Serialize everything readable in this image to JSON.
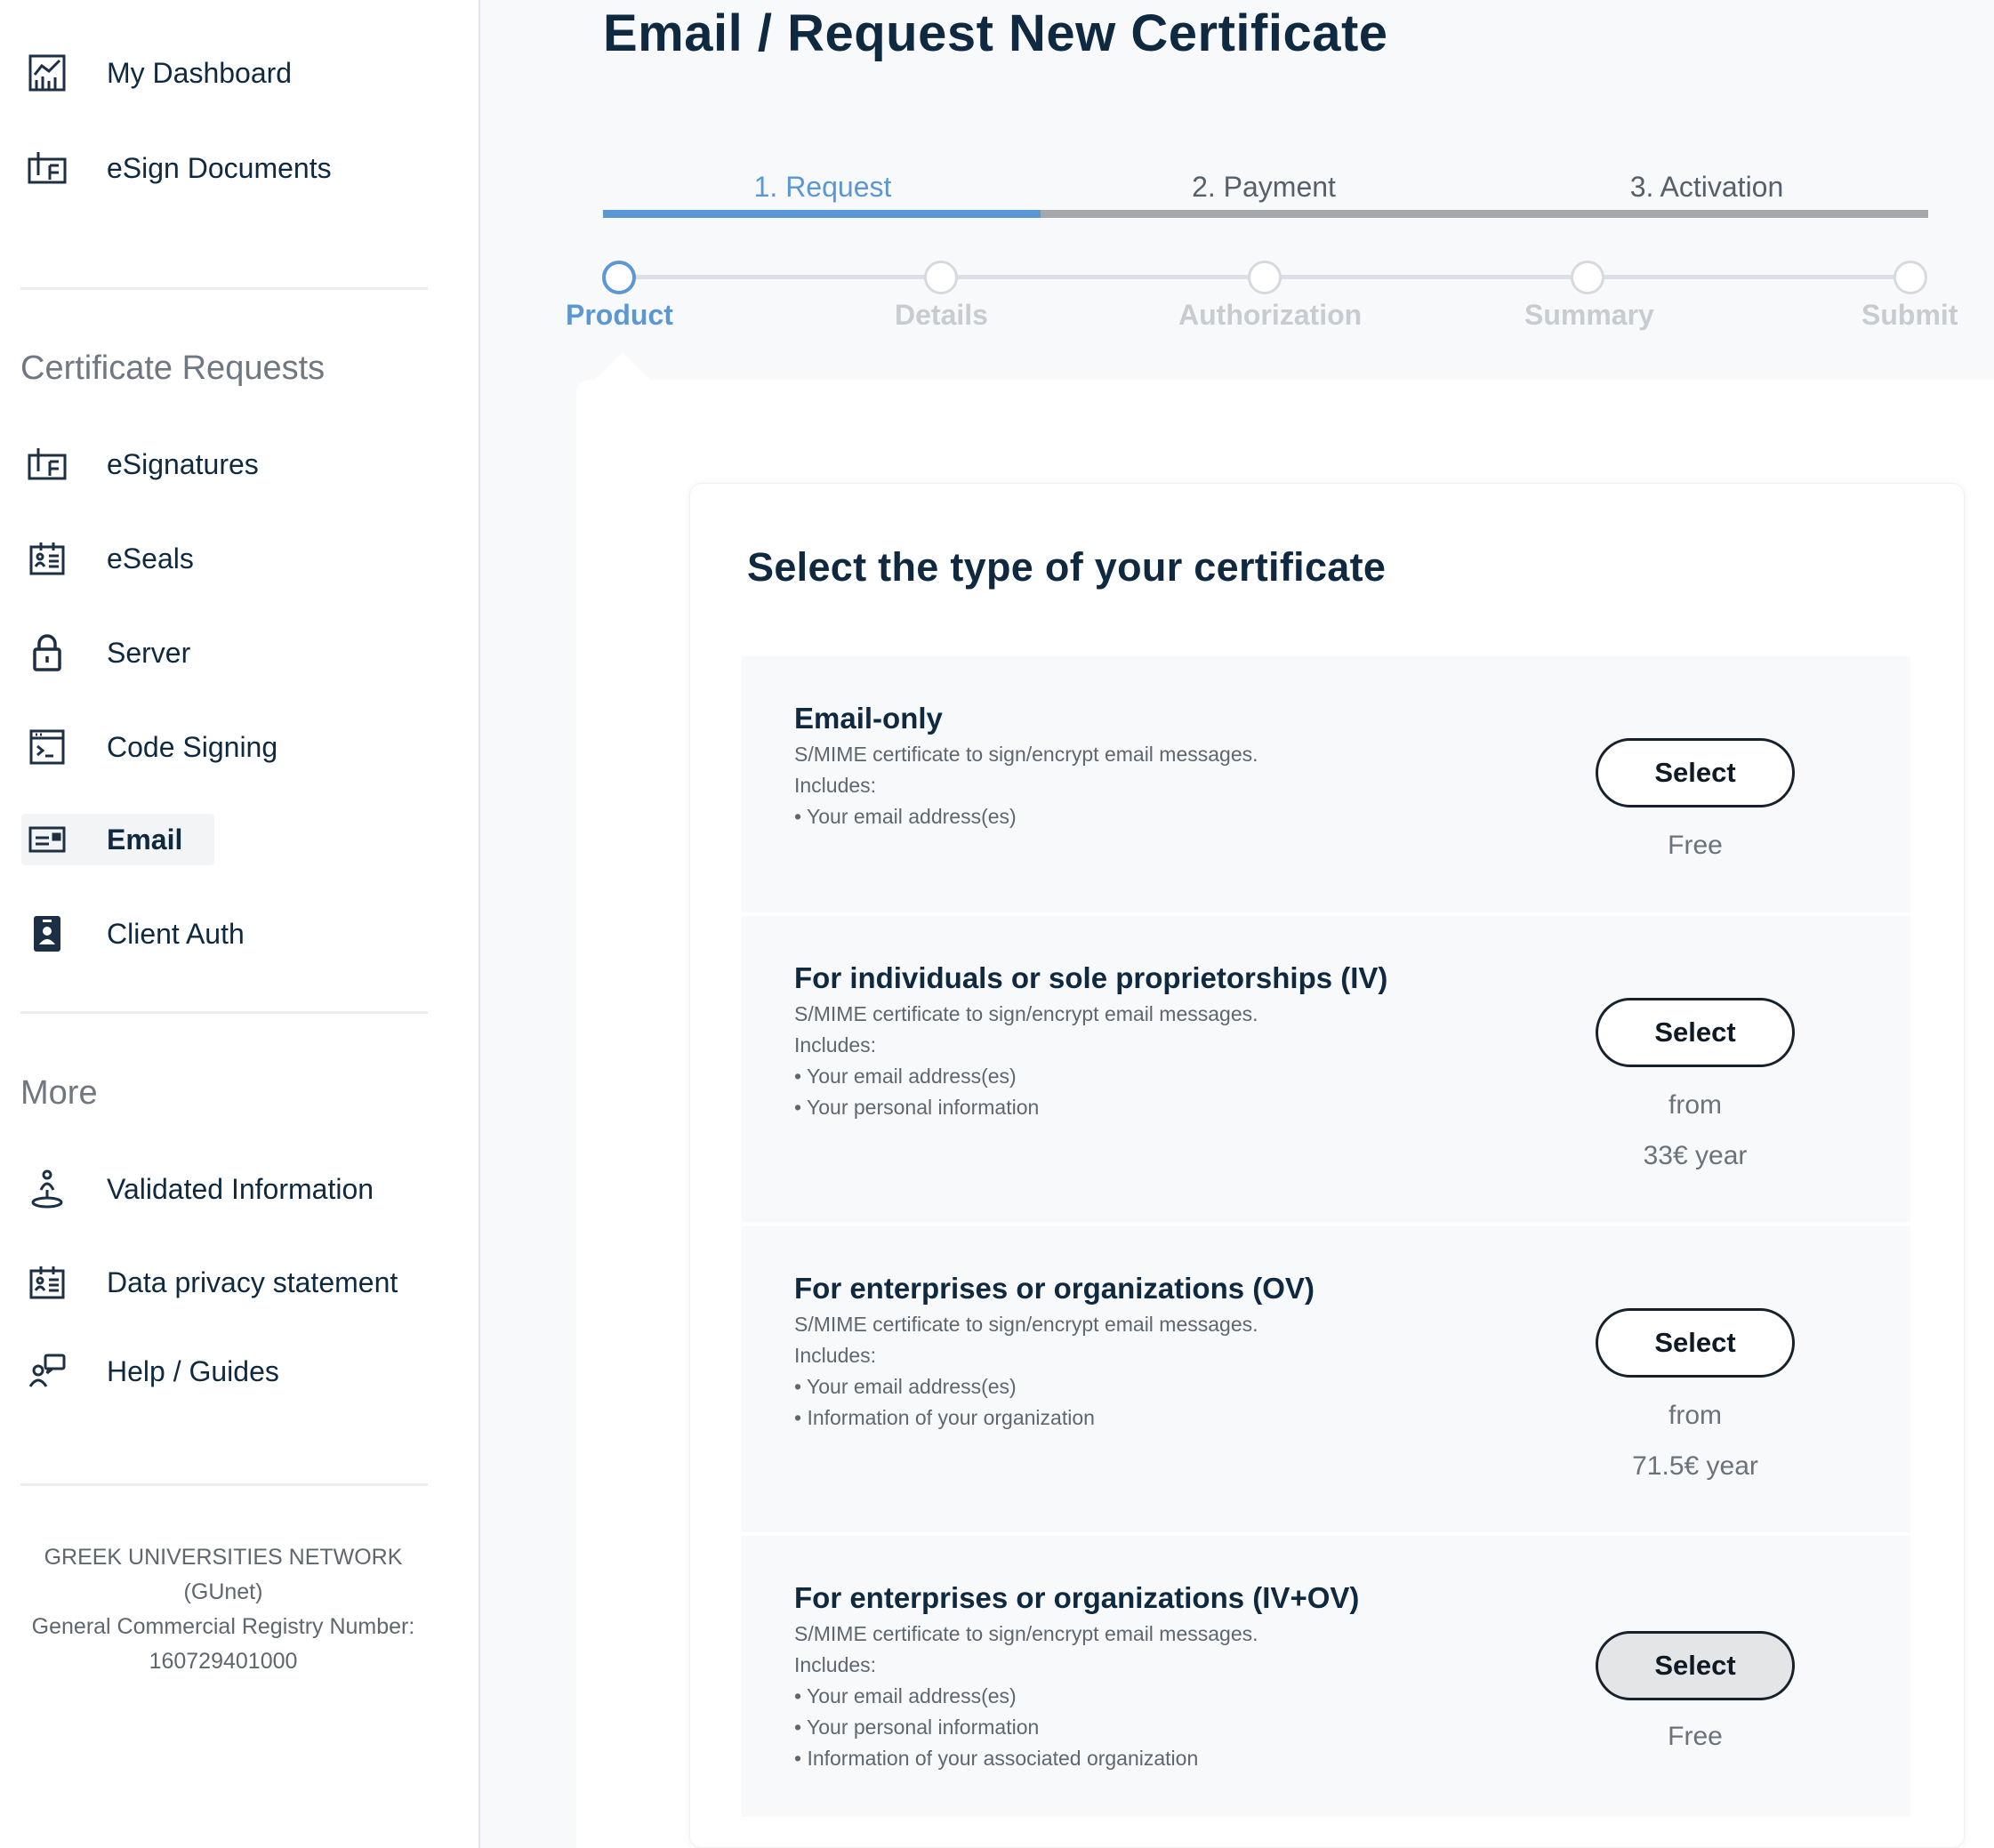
{
  "sidebar": {
    "top_items": [
      {
        "label": "My Dashboard",
        "icon": "dashboard-chart-icon"
      },
      {
        "label": "eSign Documents",
        "icon": "esign-document-icon"
      }
    ],
    "cert_section_title": "Certificate Requests",
    "cert_items": [
      {
        "label": "eSignatures",
        "icon": "esignature-icon"
      },
      {
        "label": "eSeals",
        "icon": "eseal-badge-icon"
      },
      {
        "label": "Server",
        "icon": "lock-icon"
      },
      {
        "label": "Code Signing",
        "icon": "terminal-window-icon"
      },
      {
        "label": "Email",
        "icon": "email-card-icon",
        "active": true
      },
      {
        "label": "Client Auth",
        "icon": "client-badge-icon"
      }
    ],
    "more_section_title": "More",
    "more_items": [
      {
        "label": "Validated Information",
        "icon": "validated-person-icon"
      },
      {
        "label": "Data privacy statement",
        "icon": "privacy-id-card-icon"
      },
      {
        "label": "Help / Guides",
        "icon": "help-chat-icon"
      }
    ],
    "org": {
      "line1": "GREEK UNIVERSITIES NETWORK",
      "line2": "(GUnet)",
      "line3": "General Commercial Registry Number:",
      "line4": "160729401000"
    }
  },
  "main": {
    "title": "Email / Request New Certificate",
    "steps": [
      "1. Request",
      "2. Payment",
      "3. Activation"
    ],
    "active_step": 0,
    "request_progress": 0.33,
    "substeps": [
      "Product",
      "Details",
      "Authorization",
      "Summary",
      "Submit"
    ],
    "active_substep": 0,
    "card_title": "Select the type of your certificate",
    "options": [
      {
        "title": "Email-only",
        "description": "S/MIME certificate to sign/encrypt email messages.",
        "includes_label": "Includes:",
        "includes": [
          "• Your email address(es)"
        ],
        "button": "Select",
        "price_line1": "Free",
        "price_line2": ""
      },
      {
        "title": "For individuals or sole proprietorships (IV)",
        "description": "S/MIME certificate to sign/encrypt email messages.",
        "includes_label": "Includes:",
        "includes": [
          "• Your email address(es)",
          "• Your personal information"
        ],
        "button": "Select",
        "price_line1": "from",
        "price_line2": "33€ year"
      },
      {
        "title": "For enterprises or organizations (OV)",
        "description": "S/MIME certificate to sign/encrypt email messages.",
        "includes_label": "Includes:",
        "includes": [
          "• Your email address(es)",
          "• Information of your organization"
        ],
        "button": "Select",
        "price_line1": "from",
        "price_line2": "71.5€ year"
      },
      {
        "title": "For enterprises or organizations (IV+OV)",
        "description": "S/MIME certificate to sign/encrypt email messages.",
        "includes_label": "Includes:",
        "includes": [
          "• Your email address(es)",
          "• Your personal information",
          "• Information of your associated organization"
        ],
        "button": "Select",
        "price_line1": "Free",
        "price_line2": ""
      }
    ]
  },
  "colors": {
    "accent": "#5b97d4",
    "text_dark": "#0f2940",
    "text_muted": "#5e666e",
    "inactive_step": "#c8ccd1"
  }
}
